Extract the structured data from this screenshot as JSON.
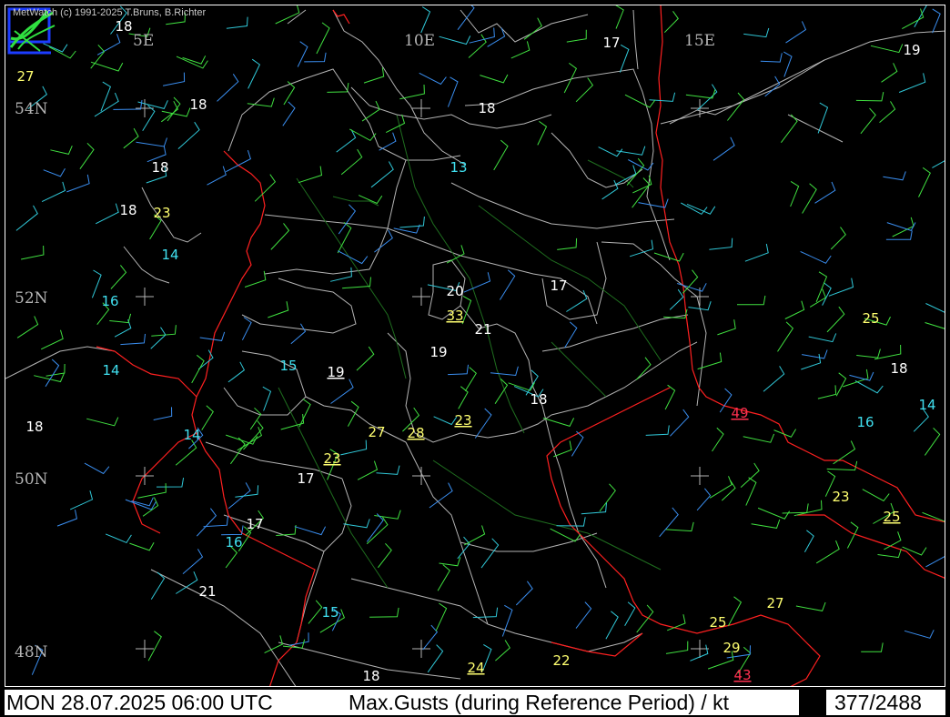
{
  "app": {
    "copyright": "MetWatch  (c) 1991-2025 T.Bruns, B.Richter",
    "logo_icon": "metwatch-logo-icon"
  },
  "status_bar": {
    "valid_time": "MON 28.07.2025 06:00 UTC",
    "parameter": "Max.Gusts (during Reference Period) / kt",
    "counter": "377/2488"
  },
  "map": {
    "grid_labels": {
      "lon_5E": "5E",
      "lon_10E": "10E",
      "lon_15E": "15E",
      "lat_54N": "54N",
      "lat_52N": "52N",
      "lat_50N": "50N",
      "lat_48N": "48N"
    },
    "colors": {
      "background": "#000000",
      "borders": "#ff2020",
      "regions": "#b4b4b4",
      "rivers": "#1f6e1f",
      "wind_green": "#40e040",
      "wind_blue": "#3a8ef0",
      "wind_cyan": "#30c8d8",
      "gust_white": "#ffffff",
      "gust_cyan": "#40e0f0",
      "gust_yellow": "#ffff70",
      "gust_red": "#ff3050"
    },
    "gust_reports_kt": [
      {
        "id": "g1",
        "value": "18"
      },
      {
        "id": "g2",
        "value": "27"
      },
      {
        "id": "g3",
        "value": "17"
      },
      {
        "id": "g4",
        "value": "19"
      },
      {
        "id": "g5",
        "value": "18"
      },
      {
        "id": "g6",
        "value": "18"
      },
      {
        "id": "g7",
        "value": "18"
      },
      {
        "id": "g8",
        "value": "13"
      },
      {
        "id": "g9",
        "value": "18"
      },
      {
        "id": "g10",
        "value": "23"
      },
      {
        "id": "g11",
        "value": "14"
      },
      {
        "id": "g12",
        "value": "16"
      },
      {
        "id": "g13",
        "value": "20"
      },
      {
        "id": "g14",
        "value": "17"
      },
      {
        "id": "g15",
        "value": "33"
      },
      {
        "id": "g16",
        "value": "21"
      },
      {
        "id": "g17",
        "value": "25"
      },
      {
        "id": "g18",
        "value": "19"
      },
      {
        "id": "g19",
        "value": "14"
      },
      {
        "id": "g20",
        "value": "15"
      },
      {
        "id": "g21",
        "value": "19"
      },
      {
        "id": "g22",
        "value": "18"
      },
      {
        "id": "g23",
        "value": "18"
      },
      {
        "id": "g24",
        "value": "49"
      },
      {
        "id": "g25",
        "value": "14"
      },
      {
        "id": "g26",
        "value": "23"
      },
      {
        "id": "g27",
        "value": "18"
      },
      {
        "id": "g28",
        "value": "14"
      },
      {
        "id": "g29",
        "value": "27"
      },
      {
        "id": "g30",
        "value": "28"
      },
      {
        "id": "g31",
        "value": "16"
      },
      {
        "id": "g32",
        "value": "23"
      },
      {
        "id": "g33",
        "value": "17"
      },
      {
        "id": "g34",
        "value": "23"
      },
      {
        "id": "g35",
        "value": "25"
      },
      {
        "id": "g36",
        "value": "17"
      },
      {
        "id": "g37",
        "value": "16"
      },
      {
        "id": "g38",
        "value": "21"
      },
      {
        "id": "g39",
        "value": "27"
      },
      {
        "id": "g40",
        "value": "15"
      },
      {
        "id": "g41",
        "value": "25"
      },
      {
        "id": "g42",
        "value": "29"
      },
      {
        "id": "g43",
        "value": "24"
      },
      {
        "id": "g44",
        "value": "22"
      },
      {
        "id": "g45",
        "value": "18"
      },
      {
        "id": "g46",
        "value": "43"
      }
    ]
  }
}
